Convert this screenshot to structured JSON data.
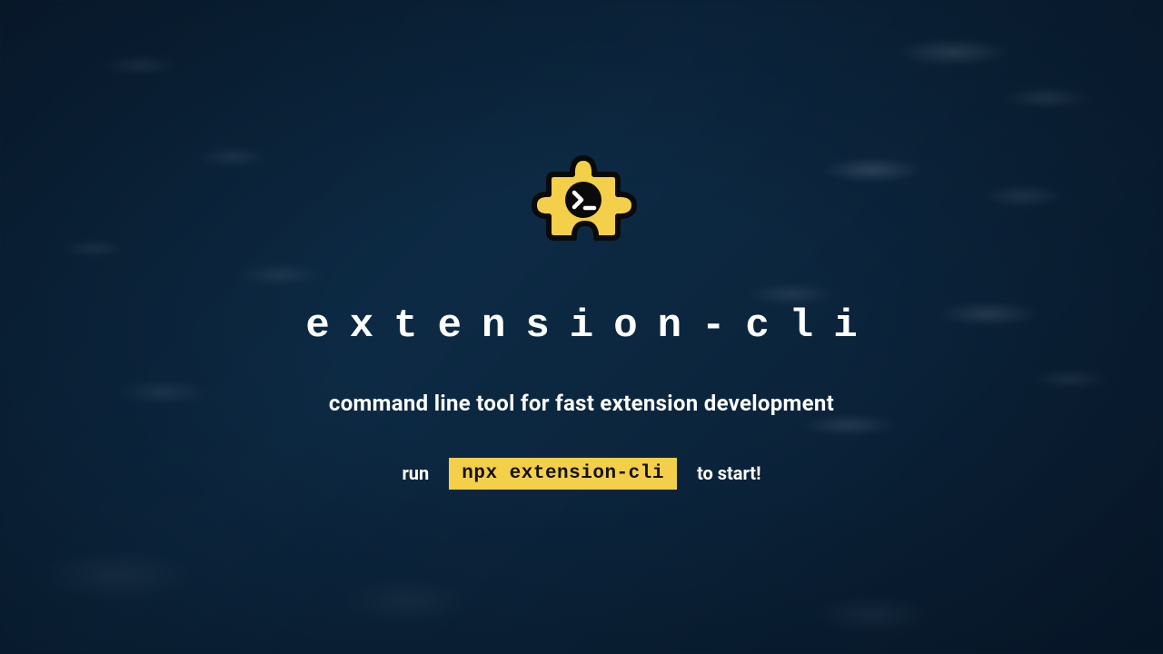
{
  "title": "extension-cli",
  "subtitle": "command line tool for fast extension development",
  "run": {
    "prefix": "run",
    "command": "npx extension-cli",
    "suffix": "to start!"
  },
  "colors": {
    "accent": "#f4cf4a",
    "background": "#0d2740",
    "text": "#ffffff",
    "icon_stroke": "#0a0a0a"
  },
  "logo": {
    "name": "puzzle-piece-terminal-icon"
  }
}
